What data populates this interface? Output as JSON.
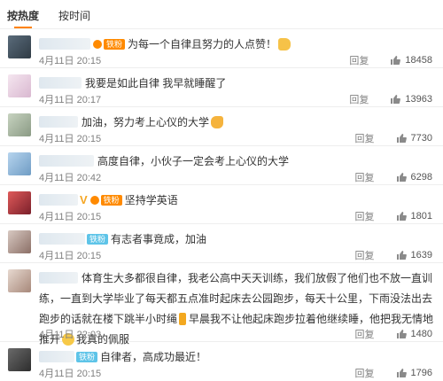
{
  "tabs": [
    {
      "label": "按热度",
      "active": true
    },
    {
      "label": "按时间",
      "active": false
    }
  ],
  "reply_label": "回复",
  "accent_color": "#ff8200",
  "comments": [
    {
      "text": "为每一个自律且努力的人点赞！",
      "time": "4月11日 20:15",
      "likes": "18458",
      "fan_badge": "铁粉",
      "emoji": "thumbs-up"
    },
    {
      "text": "我要是如此自律 我早就睡醒了",
      "time": "4月11日 20:17",
      "likes": "13963"
    },
    {
      "text": "加油，努力考上心仪的大学",
      "time": "4月11日 20:15",
      "likes": "7730",
      "emoji": "flexed-arm"
    },
    {
      "text": "高度自律，小伙子一定会考上心仪的大学",
      "time": "4月11日 20:42",
      "likes": "6298"
    },
    {
      "text": "坚持学英语",
      "time": "4月11日 20:15",
      "likes": "1801",
      "fan_badge": "铁粉"
    },
    {
      "text": "有志者事竟成，加油",
      "time": "4月11日 20:15",
      "likes": "1639",
      "fan_badge": "铁粉"
    },
    {
      "text_p1": "体育生大多都很自律，我老公高中天天训练，我们放假了他们也不放一直训练，一直到大学毕业了每天都五点准时起床去公园跑步，每天十公里，下雨没法出去跑步的话就在楼下跳半小时绳",
      "text_p2": "早晨我不让他起床跑步拉着他继续睡，他把我无情地推开",
      "text_p3": "我真的佩服",
      "time": "4月11日 22:03",
      "likes": "1480"
    },
    {
      "text": "自律者，高成功最近！",
      "time": "4月11日 20:15",
      "likes": "1796",
      "fan_badge": "铁粉"
    }
  ]
}
